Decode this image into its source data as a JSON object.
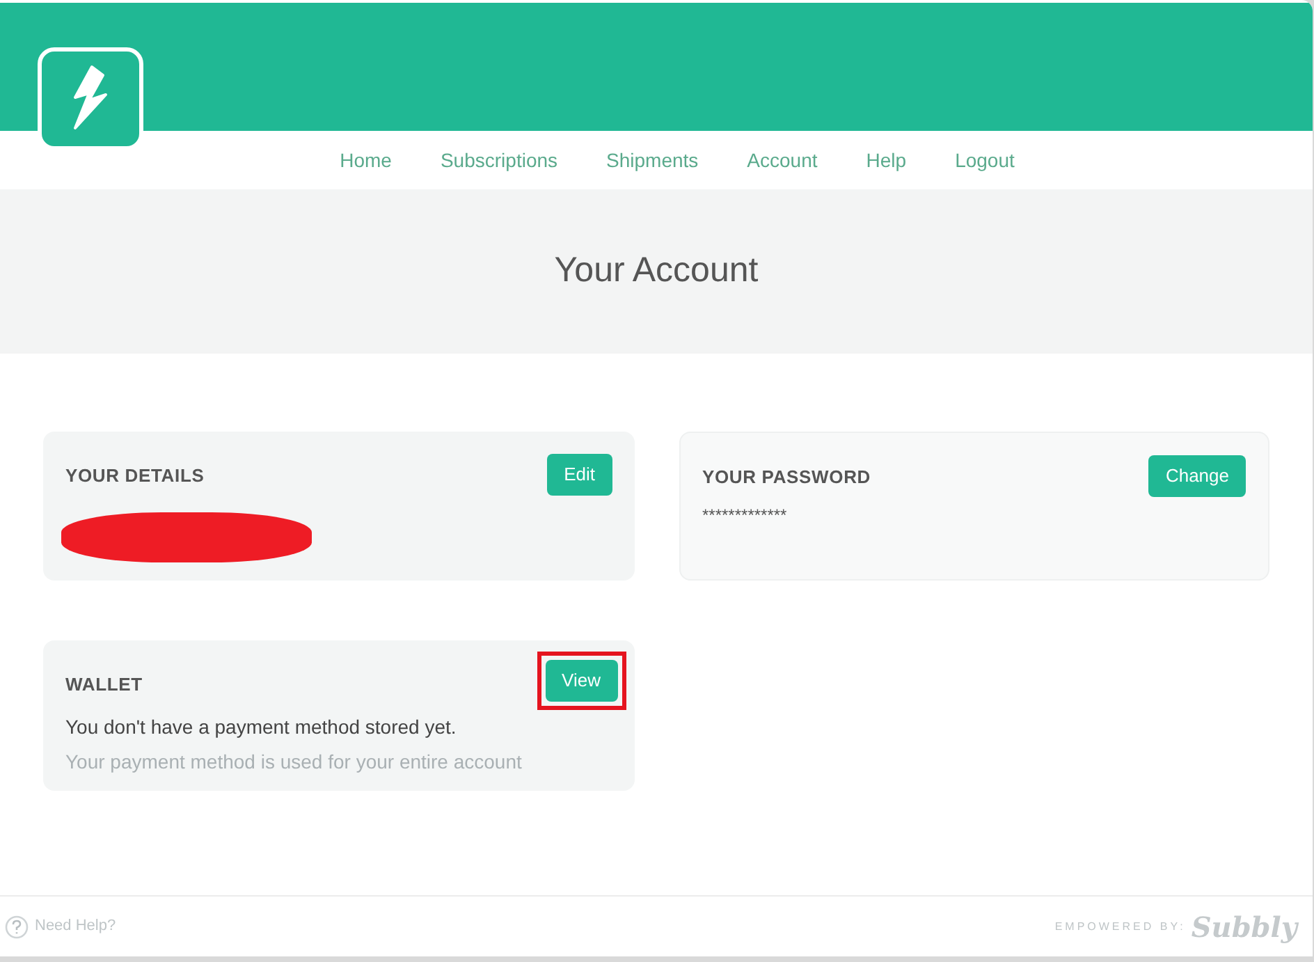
{
  "nav": [
    {
      "label": "Home"
    },
    {
      "label": "Subscriptions"
    },
    {
      "label": "Shipments"
    },
    {
      "label": "Account"
    },
    {
      "label": "Help"
    },
    {
      "label": "Logout"
    }
  ],
  "hero": {
    "title": "Your Account"
  },
  "cards": [
    {
      "kind": "details",
      "title": "YOUR DETAILS",
      "button": "Edit",
      "highlighted": false
    },
    {
      "kind": "password",
      "title": "YOUR PASSWORD",
      "button": "Change",
      "value": "*************",
      "highlighted": false
    },
    {
      "kind": "wallet",
      "title": "WALLET",
      "button": "View",
      "text": "You don't have a payment method stored yet.",
      "note": "Your payment method is used for your entire account",
      "highlighted": true
    }
  ],
  "footer": {
    "help": "Need Help?",
    "powered_by": "EMPOWERED BY:",
    "brand": "Subbly"
  }
}
